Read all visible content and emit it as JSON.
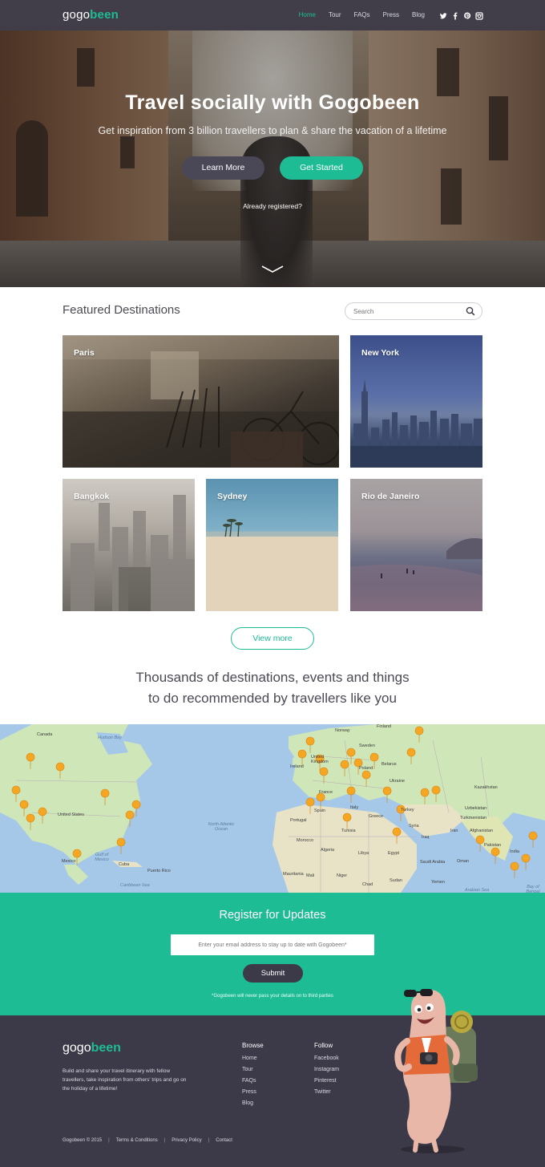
{
  "nav": {
    "logo_a": "gogo",
    "logo_b": "been",
    "links": [
      {
        "label": "Home",
        "active": true
      },
      {
        "label": "Tour",
        "active": false
      },
      {
        "label": "FAQs",
        "active": false
      },
      {
        "label": "Press",
        "active": false
      },
      {
        "label": "Blog",
        "active": false
      }
    ],
    "social_icons": [
      "twitter-icon",
      "facebook-icon",
      "pinterest-icon",
      "instagram-icon"
    ]
  },
  "hero": {
    "title": "Travel socially with Gogobeen",
    "subtitle": "Get inspiration from 3 billion travellers to plan & share the vacation of a lifetime",
    "learn_more": "Learn More",
    "get_started": "Get Started",
    "already": "Already registered?"
  },
  "featured": {
    "title": "Featured Destinations",
    "search_placeholder": "Search",
    "cards": [
      {
        "name": "Paris"
      },
      {
        "name": "New York"
      },
      {
        "name": "Bangkok"
      },
      {
        "name": "Sydney"
      },
      {
        "name": "Rio de Janeiro"
      }
    ],
    "view_more": "View more"
  },
  "tagline": {
    "line1": "Thousands of destinations, events and things",
    "line2": "to do recommended by travellers like you"
  },
  "map": {
    "labels": [
      "Canada",
      "Hudson Bay",
      "United States",
      "Gulf of Mexico",
      "Mexico",
      "Cuba",
      "Puerto Rico",
      "Caribbean Sea",
      "North Atlantic Ocean",
      "Norway",
      "Finland",
      "Sweden",
      "United Kingdom",
      "Ireland",
      "Belarus",
      "Poland",
      "Ukraine",
      "France",
      "Spain",
      "Portugal",
      "Italy",
      "Greece",
      "Turkey",
      "Kazakhstan",
      "Uzbekistan",
      "Turkmenistan",
      "Afghanistan",
      "Pakistan",
      "India",
      "Iran",
      "Iraq",
      "Syria",
      "Morocco",
      "Algeria",
      "Libya",
      "Egypt",
      "Tunisia",
      "Mauritania",
      "Mali",
      "Niger",
      "Chad",
      "Sudan",
      "Saudi Arabia",
      "Yemen",
      "Oman",
      "Arabian Sea",
      "Bay of Bengal"
    ],
    "accent_pin": "#f5a623"
  },
  "register": {
    "title": "Register for Updates",
    "email_placeholder": "Enter your email address to stay up to date with Gogobeen*",
    "submit": "Submit",
    "note": "*Gogobeen will never pass your details on to third parties"
  },
  "footer": {
    "logo_a": "gogo",
    "logo_b": "been",
    "description": "Build and share your travel itinerary with fellow travellers, take inspiration from others' trips and go on the holiday of a lifetime!",
    "browse": {
      "title": "Browse",
      "items": [
        "Home",
        "Tour",
        "FAQs",
        "Press",
        "Blog"
      ]
    },
    "follow": {
      "title": "Follow",
      "items": [
        "Facebook",
        "Instagram",
        "Pinterest",
        "Twitter"
      ]
    },
    "bottom": [
      "Gogobeen © 2015",
      "Terms & Conditions",
      "Privacy Policy",
      "Contact"
    ]
  },
  "colors": {
    "accent": "#1dbc94",
    "dark": "#3c3a48"
  }
}
